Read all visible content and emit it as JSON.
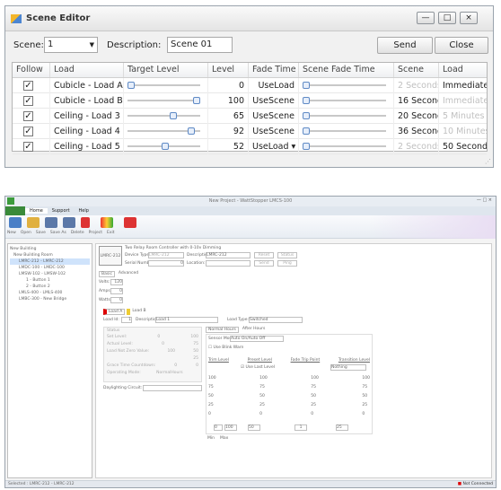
{
  "window": {
    "title": "Scene Editor",
    "min": "—",
    "max": "□",
    "close": "×"
  },
  "toolbar": {
    "scene_label": "Scene:",
    "scene_value": "1",
    "desc_label": "Description:",
    "desc_value": "Scene 01",
    "send": "Send",
    "close": "Close"
  },
  "table": {
    "headers": [
      "Follow",
      "Load",
      "Target Level",
      "Level",
      "Fade Time",
      "Scene Fade Time",
      "Scene",
      "Load"
    ],
    "rows": [
      {
        "follow": "✓",
        "load": "Cubicle - Load A",
        "target": 0,
        "level": "0",
        "fade": "UseLoad",
        "scene_fade": 0,
        "scene": "2 Seconds",
        "load2": "Immediate",
        "scene_dim": true,
        "load_dim": false
      },
      {
        "follow": "✓",
        "load": "Cubicle - Load B",
        "target": 100,
        "level": "100",
        "fade": "UseScene",
        "scene_fade": 0,
        "scene": "16 Seconds",
        "load2": "Immediate",
        "scene_dim": false,
        "load_dim": true
      },
      {
        "follow": "✓",
        "load": "Ceiling - Load 3",
        "target": 65,
        "level": "65",
        "fade": "UseScene",
        "scene_fade": 0,
        "scene": "20 Seconds",
        "load2": "5 Minutes",
        "scene_dim": false,
        "load_dim": true
      },
      {
        "follow": "✓",
        "load": "Ceiling - Load 4",
        "target": 92,
        "level": "92",
        "fade": "UseScene",
        "scene_fade": 0,
        "scene": "36 Seconds",
        "load2": "10 Minutes",
        "scene_dim": false,
        "load_dim": true
      },
      {
        "follow": "✓",
        "load": "Ceiling - Load 5",
        "target": 52,
        "level": "52",
        "fade": "UseLoad ▾",
        "scene_fade": 0,
        "scene": "2 Seconds",
        "load2": "50 Seconds",
        "scene_dim": true,
        "load_dim": false
      }
    ]
  },
  "app": {
    "title": "New Project - WattStopper LMCS-100",
    "tabs": [
      "Home",
      "Support",
      "Help"
    ],
    "groups": [
      "File",
      "Edit",
      "Project",
      "Exit"
    ],
    "buttons": [
      "New",
      "Open",
      "Save",
      "Save As",
      "Delete",
      "Project",
      "Exit"
    ],
    "tree": [
      "New Building",
      "New Building Room",
      "LMRC-212 - LMRC-212",
      "LMDC-100 - LMDC-100",
      "LMSW-102 - LMSW-102",
      "1 - Button 1",
      "2 - Button 2",
      "LMLS-400 - LMLS-400",
      "LMBC-300 - New Bridge"
    ],
    "device": {
      "heading": "Two Relay Room Controller with 0-10v Dimming",
      "model": "LMRC-212",
      "type_label": "Device Type:",
      "type_value": "LMRC-212",
      "desc_label": "Description:",
      "desc_value": "LMRC-212",
      "serial_label": "Serial Number:",
      "serial_value": "0",
      "location_label": "Location:",
      "reset": "Reset",
      "status": "Status",
      "send": "Send",
      "ping": "Ping"
    },
    "subtabs": [
      "Basic",
      "Advanced"
    ],
    "volts_label": "Volts:",
    "volts": "120",
    "amps_label": "Amps:",
    "amps": "0",
    "watts_label": "Watts:",
    "watts": "0",
    "load_tabs": [
      "Load A",
      "Load B"
    ],
    "loadid_label": "Load Id:",
    "loadid": "1",
    "ldesc_label": "Description:",
    "ldesc": "Load 1",
    "ltype_label": "Load Type:",
    "ltype": "Switched",
    "status_title": "Status",
    "status_rows": [
      [
        "Set Level:",
        "0",
        "100"
      ],
      [
        "Actual Level:",
        "0",
        "75"
      ],
      [
        "Load Not Zero Value:",
        "100",
        "50"
      ],
      [
        "",
        "",
        "25"
      ],
      [
        "Grace Time Countdown:",
        "0",
        "0"
      ],
      [
        "Operating Mode:",
        "NormalHours",
        ""
      ]
    ],
    "daylighting": "Daylighting Circuit:",
    "hours_tabs": [
      "Normal Hours",
      "After Hours"
    ],
    "sensor_label": "Sensor Mode:",
    "sensor_value": "Auto On/Auto Off",
    "blink": "Use Blink Warn",
    "col_heads": [
      "Trim Level",
      "Preset Level",
      "Fade Trip Point",
      "Transition Level"
    ],
    "use_last": "Use Last Level",
    "nothing": "Nothing",
    "scale": [
      "100",
      "75",
      "50",
      "25",
      "0"
    ],
    "min": "Min",
    "max": "Max",
    "minv": "0",
    "maxv": "100",
    "preset_v": "50",
    "fade_v": "1",
    "trans_v": "25",
    "status_bar": "Selected : LMRC-212 - LMRC-212",
    "not_connected": "Not Connected"
  }
}
